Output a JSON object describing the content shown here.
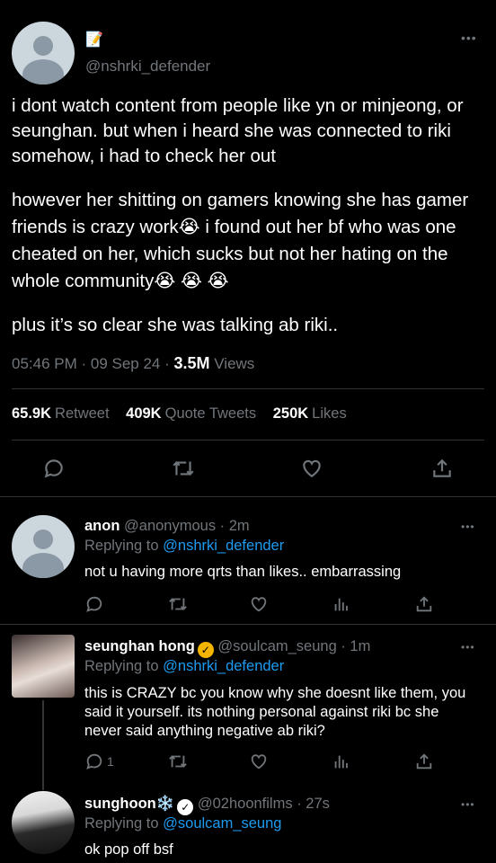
{
  "main_tweet": {
    "name_emoji": "📝",
    "handle": "@nshrki_defender",
    "more": "•••",
    "paragraphs": [
      "i dont watch content from people like yn or minjeong, or seunghan. but when i heard she was connected to riki somehow, i had to check her out",
      "however her shitting on gamers knowing she has gamer friends is crazy work😭 i found out her bf who was one cheated on her, which sucks but not her hating on the whole community😭 😭 😭",
      "plus it’s so clear she was talking ab riki.."
    ],
    "time": "05:46 PM · 09 Sep 24 · ",
    "views_count": "3.5M",
    "views_label": " Views",
    "retweets_count": "65.9K",
    "retweets_label": "Retweet",
    "quotes_count": "409K",
    "quotes_label": "Quote Tweets",
    "likes_count": "250K",
    "likes_label": "Likes"
  },
  "replies": [
    {
      "name": "anon",
      "handle": "@anonymous",
      "time": " · 2m",
      "replying_prefix": "Replying to ",
      "replying_to": "@nshrki_defender",
      "text": "not u having more qrts than likes.. embarrassing",
      "reply_count": "",
      "verified_color": ""
    },
    {
      "name": "seunghan hong",
      "handle": "@soulcam_seung",
      "time": " · 1m",
      "replying_prefix": "Replying to ",
      "replying_to": "@nshrki_defender",
      "text": "this is CRAZY bc you know why she doesnt like them, you said it yourself. its nothing personal against riki bc she never said anything negative ab riki?",
      "reply_count": "1",
      "verified_color": "#f4b400"
    },
    {
      "name": "sunghoon❄️",
      "handle": "@02hoonfilms",
      "time": " · 27s",
      "replying_prefix": "Replying to ",
      "replying_to": "@soulcam_seung",
      "text": "ok pop off bsf",
      "reply_count": "",
      "verified_color": "#ffffff"
    }
  ],
  "icons": [
    "reply-icon",
    "retweet-icon",
    "like-icon",
    "share-icon",
    "views-icon",
    "more-icon",
    "verified-icon"
  ]
}
